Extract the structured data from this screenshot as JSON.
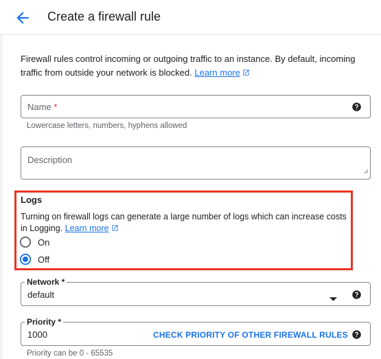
{
  "header": {
    "title": "Create a firewall rule"
  },
  "intro": {
    "text": "Firewall rules control incoming or outgoing traffic to an instance. By default, incoming traffic from outside your network is blocked.",
    "learn_more": "Learn more"
  },
  "name_field": {
    "label": "Name",
    "required_mark": "*",
    "hint": "Lowercase letters, numbers, hyphens allowed"
  },
  "description_field": {
    "label": "Description"
  },
  "logs": {
    "title": "Logs",
    "description": "Turning on firewall logs can generate a large number of logs which can increase costs in Logging.",
    "learn_more": "Learn more",
    "options": [
      {
        "label": "On",
        "selected": false
      },
      {
        "label": "Off",
        "selected": true
      }
    ]
  },
  "network_field": {
    "label": "Network *",
    "value": "default"
  },
  "priority_field": {
    "label": "Priority *",
    "value": "1000",
    "action": "CHECK PRIORITY OF OTHER FIREWALL RULES",
    "hint": "Priority can be 0 - 65535"
  },
  "colors": {
    "accent": "#1a73e8",
    "highlight_border": "#ea3323",
    "required": "#d93025"
  }
}
